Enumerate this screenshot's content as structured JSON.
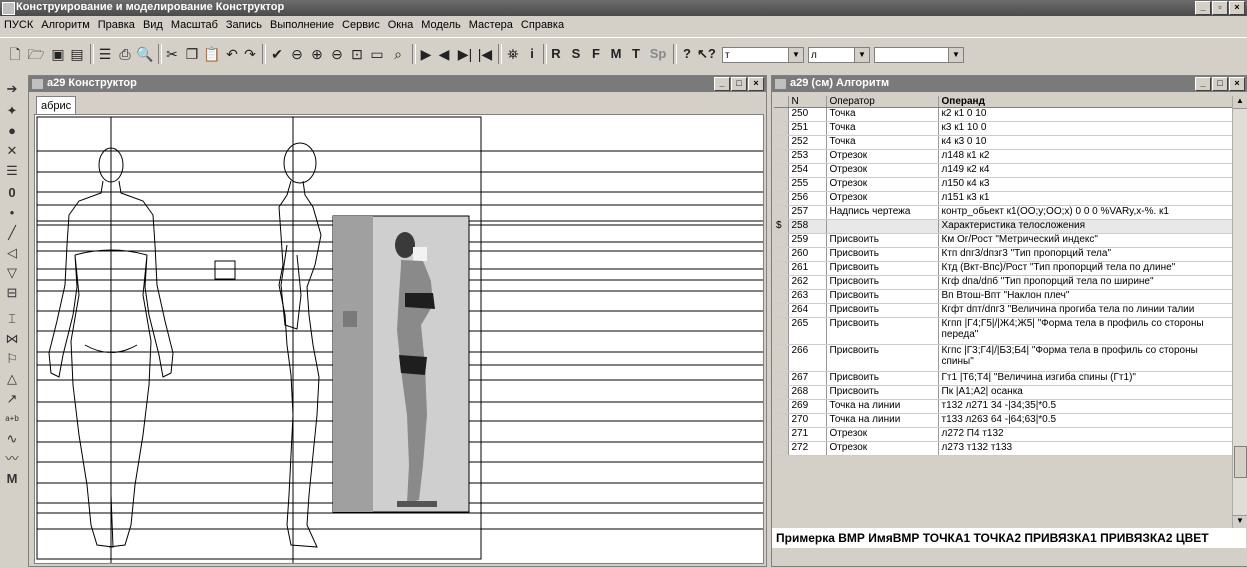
{
  "app": {
    "title": "Конструирование и моделирование Конструктор"
  },
  "menu": [
    "ПУСК",
    "Алгоритм",
    "Правка",
    "Вид",
    "Масштаб",
    "Запись",
    "Выполнение",
    "Сервис",
    "Окна",
    "Модель",
    "Мастера",
    "Справка"
  ],
  "toolbar": {
    "letters": [
      "R",
      "S",
      "F",
      "M",
      "T",
      "Sp"
    ],
    "info": "i",
    "combo1": "т",
    "combo2": "л",
    "combo3": ""
  },
  "left_tools": [
    "0",
    "•",
    "M",
    "a+b"
  ],
  "constructor": {
    "title": "а29 Конструктор",
    "tab": "абрис"
  },
  "algorithm": {
    "title": "а29 (см) Алгоритм",
    "columns": [
      "N",
      "Оператор",
      "Операнд"
    ],
    "rows": [
      {
        "mark": "",
        "n": "250",
        "op": "Точка",
        "arg": "к2 к1 0 10"
      },
      {
        "mark": "",
        "n": "251",
        "op": "Точка",
        "arg": "к3 к1 10 0"
      },
      {
        "mark": "",
        "n": "252",
        "op": "Точка",
        "arg": "к4 к3 0 10"
      },
      {
        "mark": "",
        "n": "253",
        "op": "Отрезок",
        "arg": "л148 к1 к2"
      },
      {
        "mark": "",
        "n": "254",
        "op": "Отрезок",
        "arg": "л149 к2 к4"
      },
      {
        "mark": "",
        "n": "255",
        "op": "Отрезок",
        "arg": "л150 к4 к3"
      },
      {
        "mark": "",
        "n": "256",
        "op": "Отрезок",
        "arg": "л151 к3 к1"
      },
      {
        "mark": "",
        "n": "257",
        "op": "Надпись чертежа",
        "arg": "контр_обьект к1(ОО;у;ОО;х) 0 0 0 %VARy,х-%. к1"
      },
      {
        "mark": "$",
        "n": "258",
        "op": "",
        "arg": "Характеристика телосложения"
      },
      {
        "mark": "",
        "n": "259",
        "op": "Присвоить",
        "arg": "Км Ог/Рост \"Метрический индекс\""
      },
      {
        "mark": "",
        "n": "260",
        "op": "Присвоить",
        "arg": "Ктп dпг3/dпзг3 \"Тип пропорций тела\""
      },
      {
        "mark": "",
        "n": "261",
        "op": "Присвоить",
        "arg": "Ктд (Вкт-Впс)/Рост \"Тип пропорций тела по длине\""
      },
      {
        "mark": "",
        "n": "262",
        "op": "Присвоить",
        "arg": "Кгф dпа/dпб \"Тип пропорций тела по ширине\""
      },
      {
        "mark": "",
        "n": "263",
        "op": "Присвоить",
        "arg": "Вп  Втош-Впт \"Наклон плеч\""
      },
      {
        "mark": "",
        "n": "264",
        "op": "Присвоить",
        "arg": "Кгфт dпт/dпг3 \"Величина прогиба тела по линии талии"
      },
      {
        "mark": "",
        "n": "265",
        "op": "Присвоить",
        "arg": "Кгпп |Г4;Г5|/|Ж4;Ж5| \"Форма тела в профиль со стороны переда\""
      },
      {
        "mark": "",
        "n": "266",
        "op": "Присвоить",
        "arg": "Кгпс |Г3;Г4|/|Б3;Б4| \"Форма тела в профиль со стороны спины\""
      },
      {
        "mark": "",
        "n": "267",
        "op": "Присвоить",
        "arg": "Гт1 |Т6;Т4| \"Величина изгиба спины (Гт1)\""
      },
      {
        "mark": "",
        "n": "268",
        "op": "Присвоить",
        "arg": "Пк |А1;А2| осанка"
      },
      {
        "mark": "",
        "n": "269",
        "op": "Точка на линии",
        "arg": "т132 л271 34 -|34;35|*0.5"
      },
      {
        "mark": "",
        "n": "270",
        "op": "Точка на линии",
        "arg": "т133 л263 64 -|64;63|*0.5"
      },
      {
        "mark": "",
        "n": "271",
        "op": "Отрезок",
        "arg": "л272 П4 т132"
      },
      {
        "mark": "",
        "n": "272",
        "op": "Отрезок",
        "arg": "л273 т132 т133"
      }
    ],
    "status": "Примерка ВМР ИмяВМР ТОЧКА1 ТОЧКА2 ПРИВЯЗКА1 ПРИВЯЗКА2 ЦВЕТ"
  }
}
